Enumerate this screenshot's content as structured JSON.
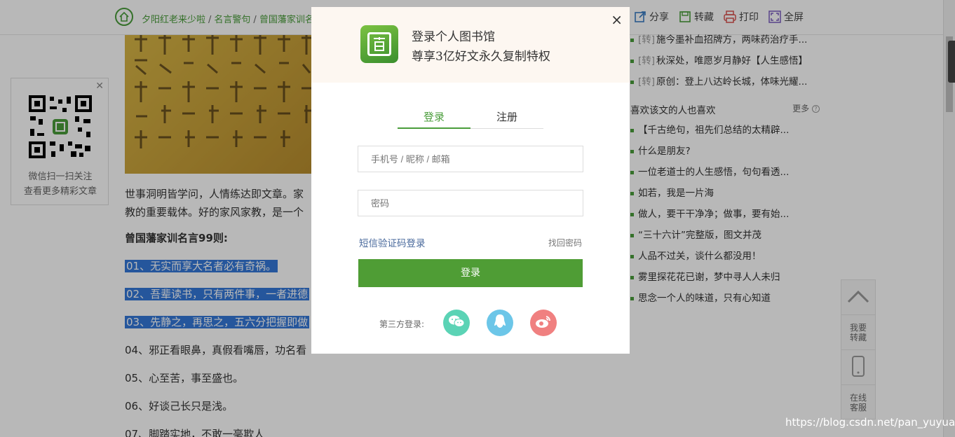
{
  "breadcrumb": {
    "items": [
      "夕阳红老来少啦",
      "名言警句",
      "曾国藩家训名"
    ],
    "separator": "/"
  },
  "toolbar": {
    "share": "分享",
    "save": "转藏",
    "print": "打印",
    "fullscreen": "全屏"
  },
  "qr_box": {
    "line1": "微信扫一扫关注",
    "line2": "查看更多精彩文章"
  },
  "article": {
    "para1": "世事洞明皆学问，人情练达即文章。家",
    "para2": "教的重要载体。好的家风家教，是一个",
    "heading": "曾国藩家训名言99则:",
    "lines": [
      {
        "text": "01、无实而享大名者必有奇祸。",
        "selected": true
      },
      {
        "text": "02、吾辈读书，只有两件事，一者进德",
        "selected": true
      },
      {
        "text": "03、先静之，再思之，五六分把握即做",
        "selected": true
      },
      {
        "text": "04、邪正看眼鼻，真假看嘴唇，功名看",
        "selected": false
      },
      {
        "text": "05、心至苦，事至盛也。",
        "selected": false
      },
      {
        "text": "06、好谈己长只是浅。",
        "selected": false
      },
      {
        "text": "07、脚踏实地，不敢一毫欺人",
        "selected": false
      }
    ]
  },
  "right_top_list": [
    {
      "tag": "[转]",
      "text": "施今墨补血招牌方，两味药治疗手..."
    },
    {
      "tag": "[转]",
      "text": "秋深处，唯愿岁月静好【人生感悟】"
    },
    {
      "tag": "[转]",
      "text": "原创：登上八达岭长城，体味光耀..."
    }
  ],
  "right_section": {
    "title": "喜欢该文的人也喜欢",
    "more": "更多"
  },
  "right_list": [
    "【千古绝句，祖先们总结的太精辟...",
    "什么是朋友?",
    "一位老道士的人生感悟，句句看透...",
    "如若，我是一片海",
    "做人，要干干净净；做事，要有始...",
    "“三十六计”完整版，图文并茂",
    "人品不过关，谈什么都没用！",
    "雾里探花花已谢，梦中寻人人未归",
    "思念一个人的味道，只有心知道"
  ],
  "side_float": {
    "collect": "我要\n转藏",
    "service": "在线\n客服"
  },
  "modal": {
    "title_line1": "登录个人图书馆",
    "title_line2": "尊享3亿好文永久复制特权",
    "close": "×",
    "tab_login": "登录",
    "tab_register": "注册",
    "username_placeholder": "手机号 / 昵称 / 邮箱",
    "password_placeholder": "密码",
    "sms_login": "短信验证码登录",
    "find_password": "找回密码",
    "login_button": "登录",
    "third_party": "第三方登录:"
  },
  "watermark": "https://blog.csdn.net/pan_yuyuan",
  "colors": {
    "brand_green": "#4f9d35",
    "selection_blue": "#3478d8",
    "link_blue": "#4a6a9c"
  },
  "icons": [
    "home-icon",
    "share-icon",
    "save-icon",
    "print-icon",
    "fullscreen-icon",
    "close-icon",
    "wechat-icon",
    "qq-icon",
    "weibo-icon",
    "chevron-up-icon",
    "phone-icon"
  ]
}
